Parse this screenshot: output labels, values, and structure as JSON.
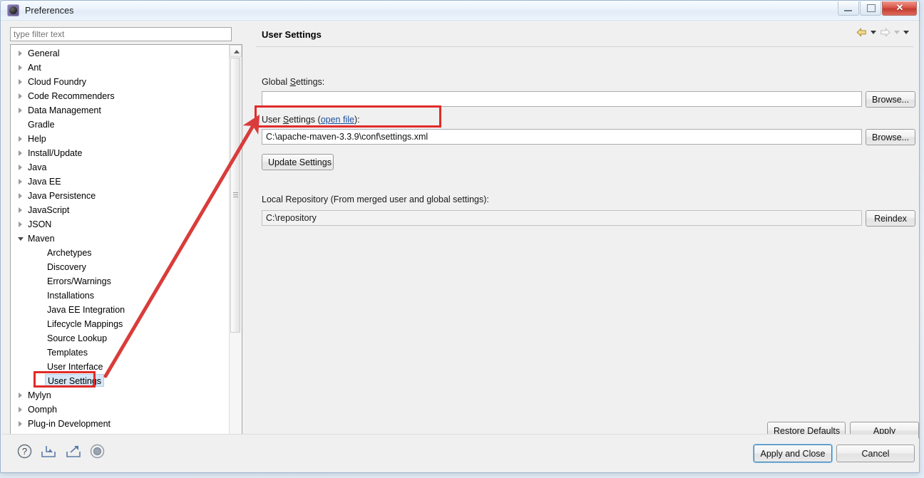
{
  "window": {
    "title": "Preferences",
    "icon": "eclipse-icon",
    "buttons": {
      "minimize": "minimize",
      "maximize": "restore",
      "close": "✕"
    }
  },
  "left_pane": {
    "filter": {
      "value": "",
      "placeholder": "type filter text"
    },
    "tree": [
      {
        "label": "General",
        "state": "collapsed",
        "level": 0,
        "selected": false
      },
      {
        "label": "Ant",
        "state": "collapsed",
        "level": 0,
        "selected": false
      },
      {
        "label": "Cloud Foundry",
        "state": "collapsed",
        "level": 0,
        "selected": false
      },
      {
        "label": "Code Recommenders",
        "state": "collapsed",
        "level": 0,
        "selected": false
      },
      {
        "label": "Data Management",
        "state": "collapsed",
        "level": 0,
        "selected": false
      },
      {
        "label": "Gradle",
        "state": "leaf",
        "level": 0,
        "selected": false
      },
      {
        "label": "Help",
        "state": "collapsed",
        "level": 0,
        "selected": false
      },
      {
        "label": "Install/Update",
        "state": "collapsed",
        "level": 0,
        "selected": false
      },
      {
        "label": "Java",
        "state": "collapsed",
        "level": 0,
        "selected": false
      },
      {
        "label": "Java EE",
        "state": "collapsed",
        "level": 0,
        "selected": false
      },
      {
        "label": "Java Persistence",
        "state": "collapsed",
        "level": 0,
        "selected": false
      },
      {
        "label": "JavaScript",
        "state": "collapsed",
        "level": 0,
        "selected": false
      },
      {
        "label": "JSON",
        "state": "collapsed",
        "level": 0,
        "selected": false
      },
      {
        "label": "Maven",
        "state": "expanded",
        "level": 0,
        "selected": false
      },
      {
        "label": "Archetypes",
        "state": "leaf",
        "level": 1,
        "selected": false
      },
      {
        "label": "Discovery",
        "state": "leaf",
        "level": 1,
        "selected": false
      },
      {
        "label": "Errors/Warnings",
        "state": "leaf",
        "level": 1,
        "selected": false
      },
      {
        "label": "Installations",
        "state": "leaf",
        "level": 1,
        "selected": false
      },
      {
        "label": "Java EE Integration",
        "state": "leaf",
        "level": 1,
        "selected": false
      },
      {
        "label": "Lifecycle Mappings",
        "state": "leaf",
        "level": 1,
        "selected": false
      },
      {
        "label": "Source Lookup",
        "state": "leaf",
        "level": 1,
        "selected": false
      },
      {
        "label": "Templates",
        "state": "leaf",
        "level": 1,
        "selected": false
      },
      {
        "label": "User Interface",
        "state": "leaf",
        "level": 1,
        "selected": false
      },
      {
        "label": "User Settings",
        "state": "leaf",
        "level": 1,
        "selected": true
      },
      {
        "label": "Mylyn",
        "state": "collapsed",
        "level": 0,
        "selected": false
      },
      {
        "label": "Oomph",
        "state": "collapsed",
        "level": 0,
        "selected": false
      },
      {
        "label": "Plug-in Development",
        "state": "collapsed",
        "level": 0,
        "selected": false
      }
    ]
  },
  "right_pane": {
    "page_title": "User Settings",
    "nav": {
      "back": "back-arrow",
      "back_menu": "chevron-down",
      "forward": "forward-arrow",
      "forward_menu": "chevron-down",
      "view_menu": "chevron-down"
    },
    "global_settings": {
      "label_prefix": "Global ",
      "label_mnemonic": "S",
      "label_suffix": "ettings:",
      "value": "",
      "browse_label": "Browse..."
    },
    "user_settings": {
      "label_prefix": "User ",
      "label_mnemonic": "S",
      "label_mid": "ettings (",
      "link": "open file",
      "label_suffix": "):",
      "value": "C:\\apache-maven-3.3.9\\conf\\settings.xml",
      "browse_label": "Browse...",
      "update_label": "Update Settings"
    },
    "local_repository": {
      "label": "Local Repository (From merged user and global settings):",
      "value": "C:\\repository",
      "reindex_label": "Reindex"
    },
    "restore_defaults_label": "Restore Defaults",
    "apply_label": "Apply"
  },
  "footer": {
    "icons": [
      "help-icon",
      "import-icon",
      "export-icon",
      "oomph-recorder-icon"
    ],
    "apply_and_close_label": "Apply and Close",
    "cancel_label": "Cancel"
  },
  "annotations": {
    "color": "#e02b28",
    "highlight_user_settings_field": true,
    "highlight_tree_user_settings": true,
    "arrow_from_tree_to_field": true
  }
}
